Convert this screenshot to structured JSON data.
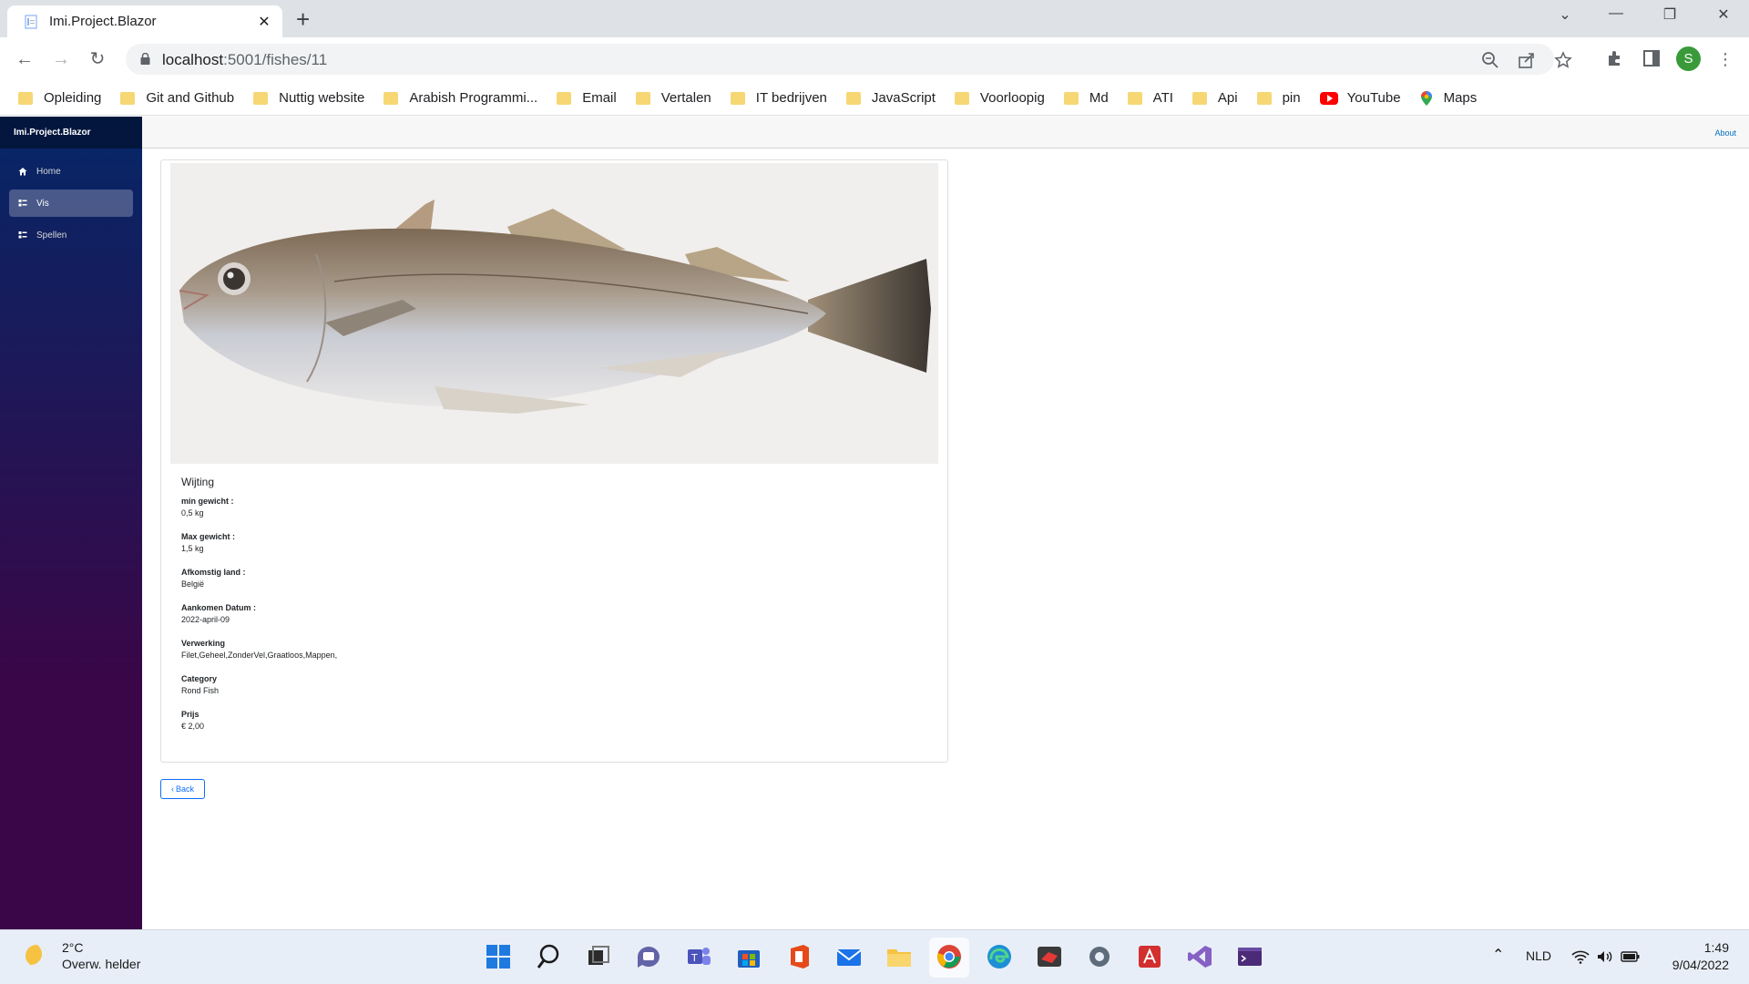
{
  "browser": {
    "tab_title": "Imi.Project.Blazor",
    "url_host": "localhost",
    "url_path": ":5001/fishes/11",
    "bookmarks": [
      {
        "label": "Opleiding",
        "icon": "folder-icon"
      },
      {
        "label": "Git and Github",
        "icon": "folder-icon"
      },
      {
        "label": "Nuttig website",
        "icon": "folder-icon"
      },
      {
        "label": "Arabish Programmi...",
        "icon": "folder-icon"
      },
      {
        "label": "Email",
        "icon": "folder-icon"
      },
      {
        "label": "Vertalen",
        "icon": "folder-icon"
      },
      {
        "label": "IT bedrijven",
        "icon": "folder-icon"
      },
      {
        "label": "JavaScript",
        "icon": "folder-icon"
      },
      {
        "label": "Voorloopig",
        "icon": "folder-icon"
      },
      {
        "label": "Md",
        "icon": "folder-icon"
      },
      {
        "label": "ATI",
        "icon": "folder-icon"
      },
      {
        "label": "Api",
        "icon": "folder-icon"
      },
      {
        "label": "pin",
        "icon": "folder-icon"
      },
      {
        "label": "YouTube",
        "icon": "youtube-icon"
      },
      {
        "label": "Maps",
        "icon": "maps-icon"
      }
    ],
    "profile_initial": "S"
  },
  "app": {
    "brand": "Imi.Project.Blazor",
    "nav": [
      {
        "label": "Home",
        "icon": "home-icon",
        "active": false
      },
      {
        "label": "Vis",
        "icon": "list-icon",
        "active": true
      },
      {
        "label": "Spellen",
        "icon": "list-icon",
        "active": false
      }
    ],
    "about_link": "About"
  },
  "fish": {
    "name": "Wijting",
    "fields": [
      {
        "label": "min gewicht :",
        "value": "0,5 kg"
      },
      {
        "label": "Max gewicht :",
        "value": "1,5 kg"
      },
      {
        "label": "Afkomstig land :",
        "value": "België"
      },
      {
        "label": "Aankomen Datum :",
        "value": "2022-april-09"
      },
      {
        "label": "Verwerking",
        "value": "Filet,Geheel,ZonderVel,Graatloos,Mappen,"
      },
      {
        "label": "Category",
        "value": "Rond Fish"
      },
      {
        "label": "Prijs",
        "value": "€ 2,00"
      }
    ],
    "back_label": "Back"
  },
  "taskbar": {
    "temperature": "2°C",
    "weather": "Overw. helder",
    "language": "NLD",
    "time": "1:49",
    "date": "9/04/2022"
  }
}
